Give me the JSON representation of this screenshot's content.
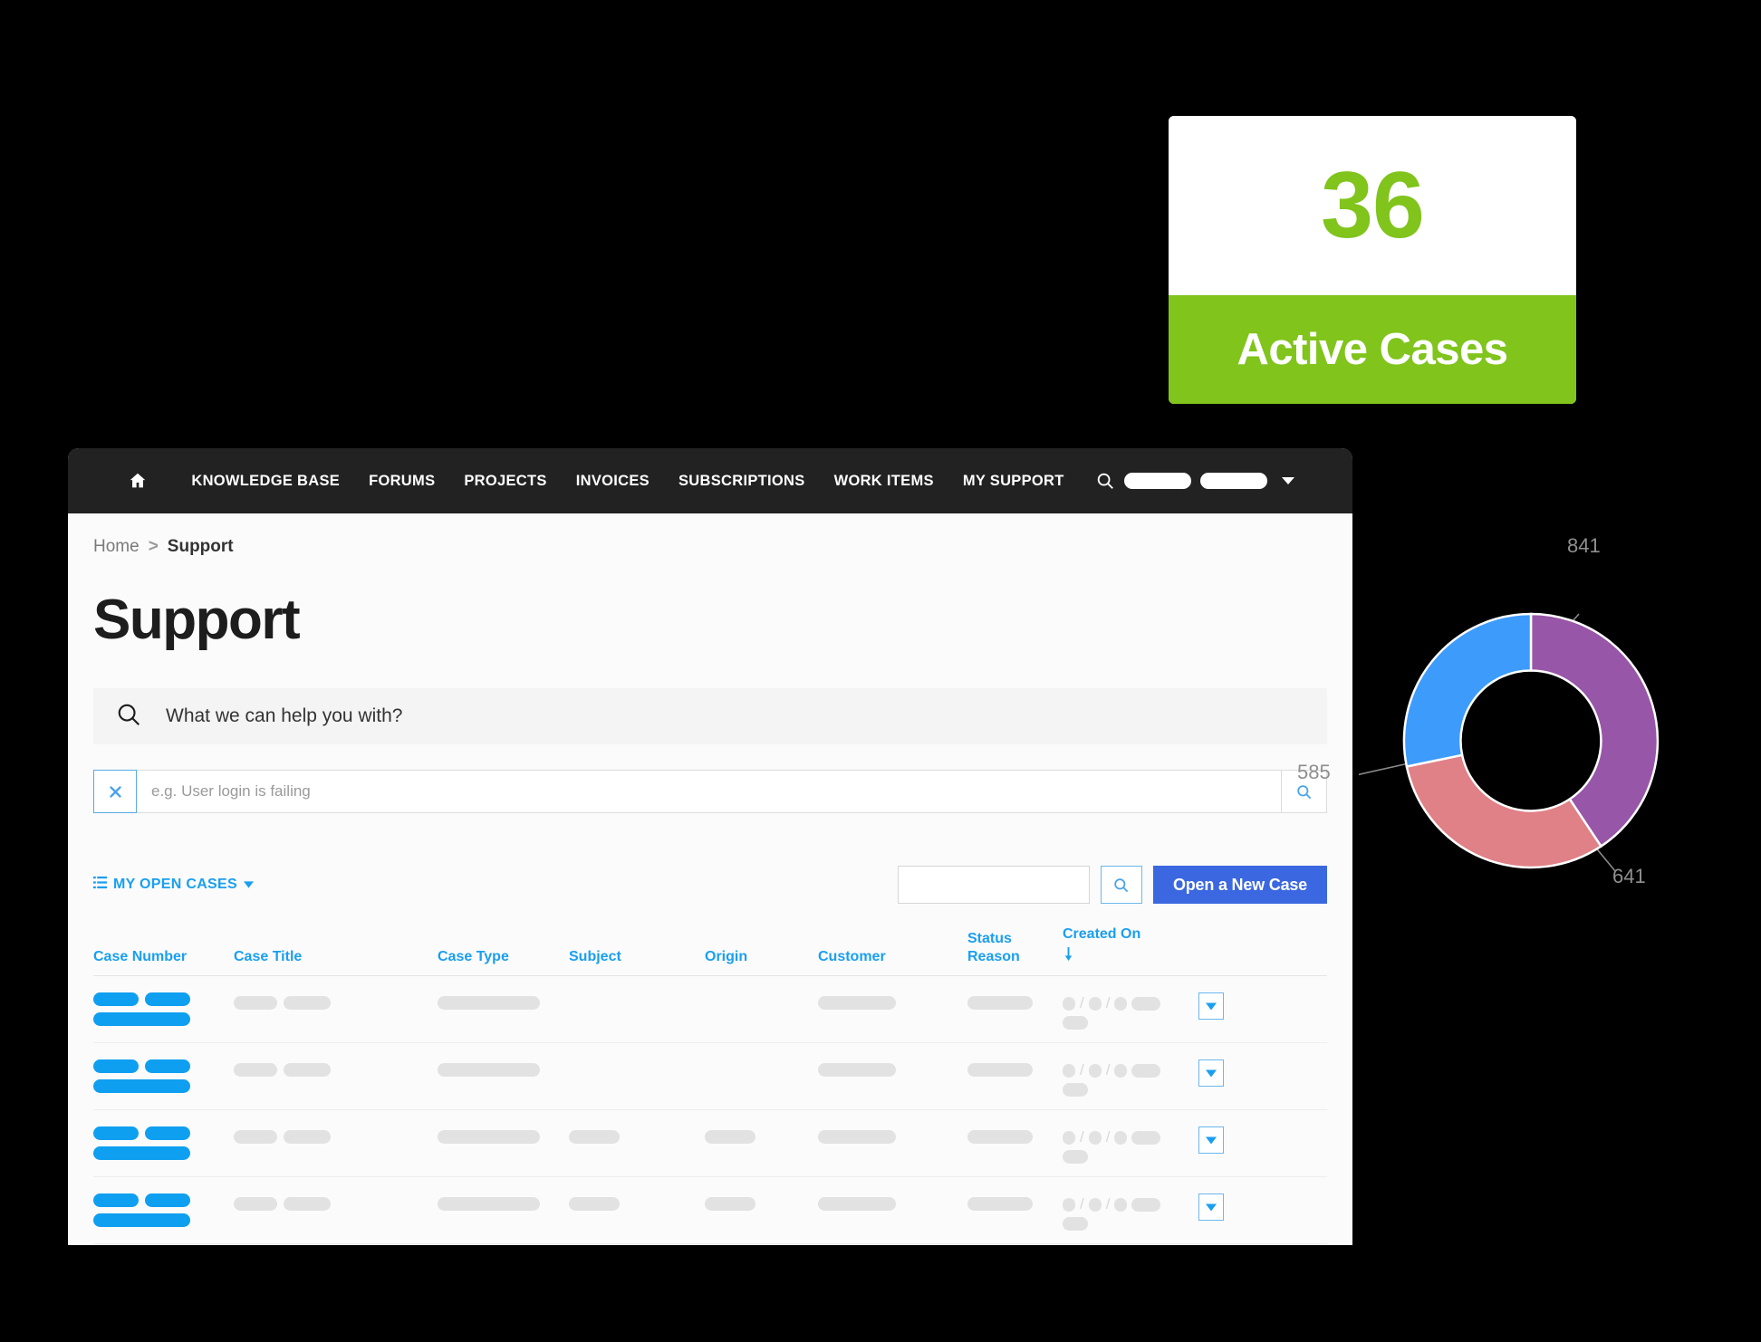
{
  "kpi_card": {
    "value": "36",
    "label": "Active Cases",
    "accent_color": "#80c41c"
  },
  "topnav": {
    "home_icon": "home-icon",
    "search_icon": "search-icon",
    "items": [
      {
        "label": "KNOWLEDGE BASE"
      },
      {
        "label": "FORUMS"
      },
      {
        "label": "PROJECTS"
      },
      {
        "label": "INVOICES"
      },
      {
        "label": "SUBSCRIPTIONS"
      },
      {
        "label": "WORK ITEMS"
      },
      {
        "label": "MY SUPPORT"
      }
    ]
  },
  "breadcrumb": {
    "home": "Home",
    "separator": ">",
    "current": "Support"
  },
  "page": {
    "title": "Support"
  },
  "help_search": {
    "icon": "search-icon",
    "placeholder": "What we can help you with?"
  },
  "kb_search": {
    "clear_icon": "close-icon",
    "value": "",
    "placeholder": "e.g. User login is failing",
    "submit_icon": "search-icon"
  },
  "toolbar": {
    "view_icon": "list-icon",
    "view_label": "MY OPEN CASES",
    "view_caret": "caret-down-icon",
    "grid_search_value": "",
    "grid_search_icon": "search-icon",
    "new_case_label": "Open a New Case",
    "new_case_color": "#3b68e0"
  },
  "table": {
    "columns": [
      {
        "label": "Case Number",
        "key": "case_number"
      },
      {
        "label": "Case Title",
        "key": "case_title"
      },
      {
        "label": "Case Type",
        "key": "case_type"
      },
      {
        "label": "Subject",
        "key": "subject"
      },
      {
        "label": "Origin",
        "key": "origin"
      },
      {
        "label": "Customer",
        "key": "customer"
      },
      {
        "label": "Status Reason",
        "key": "status_reason"
      },
      {
        "label": "Created On",
        "key": "created_on",
        "sort": "descending",
        "sort_icon": "arrow-down-icon"
      }
    ],
    "rows_redacted": true,
    "row_count": 5,
    "row_action_icon": "chevron-down-icon",
    "skeleton_blue": "#0f9ff0",
    "skeleton_gray": "#e2e2e2"
  },
  "chart_data": {
    "type": "pie",
    "variant": "donut",
    "title": "",
    "labels": [
      "841",
      "641",
      "585"
    ],
    "values": [
      841,
      641,
      585
    ],
    "colors": [
      "#9856a8",
      "#e08087",
      "#3d9bfb"
    ],
    "total": 2067,
    "legend": "none",
    "annotations": [
      {
        "text": "841",
        "position": "top-right"
      },
      {
        "text": "641",
        "position": "bottom-right"
      },
      {
        "text": "585",
        "position": "left"
      }
    ]
  }
}
